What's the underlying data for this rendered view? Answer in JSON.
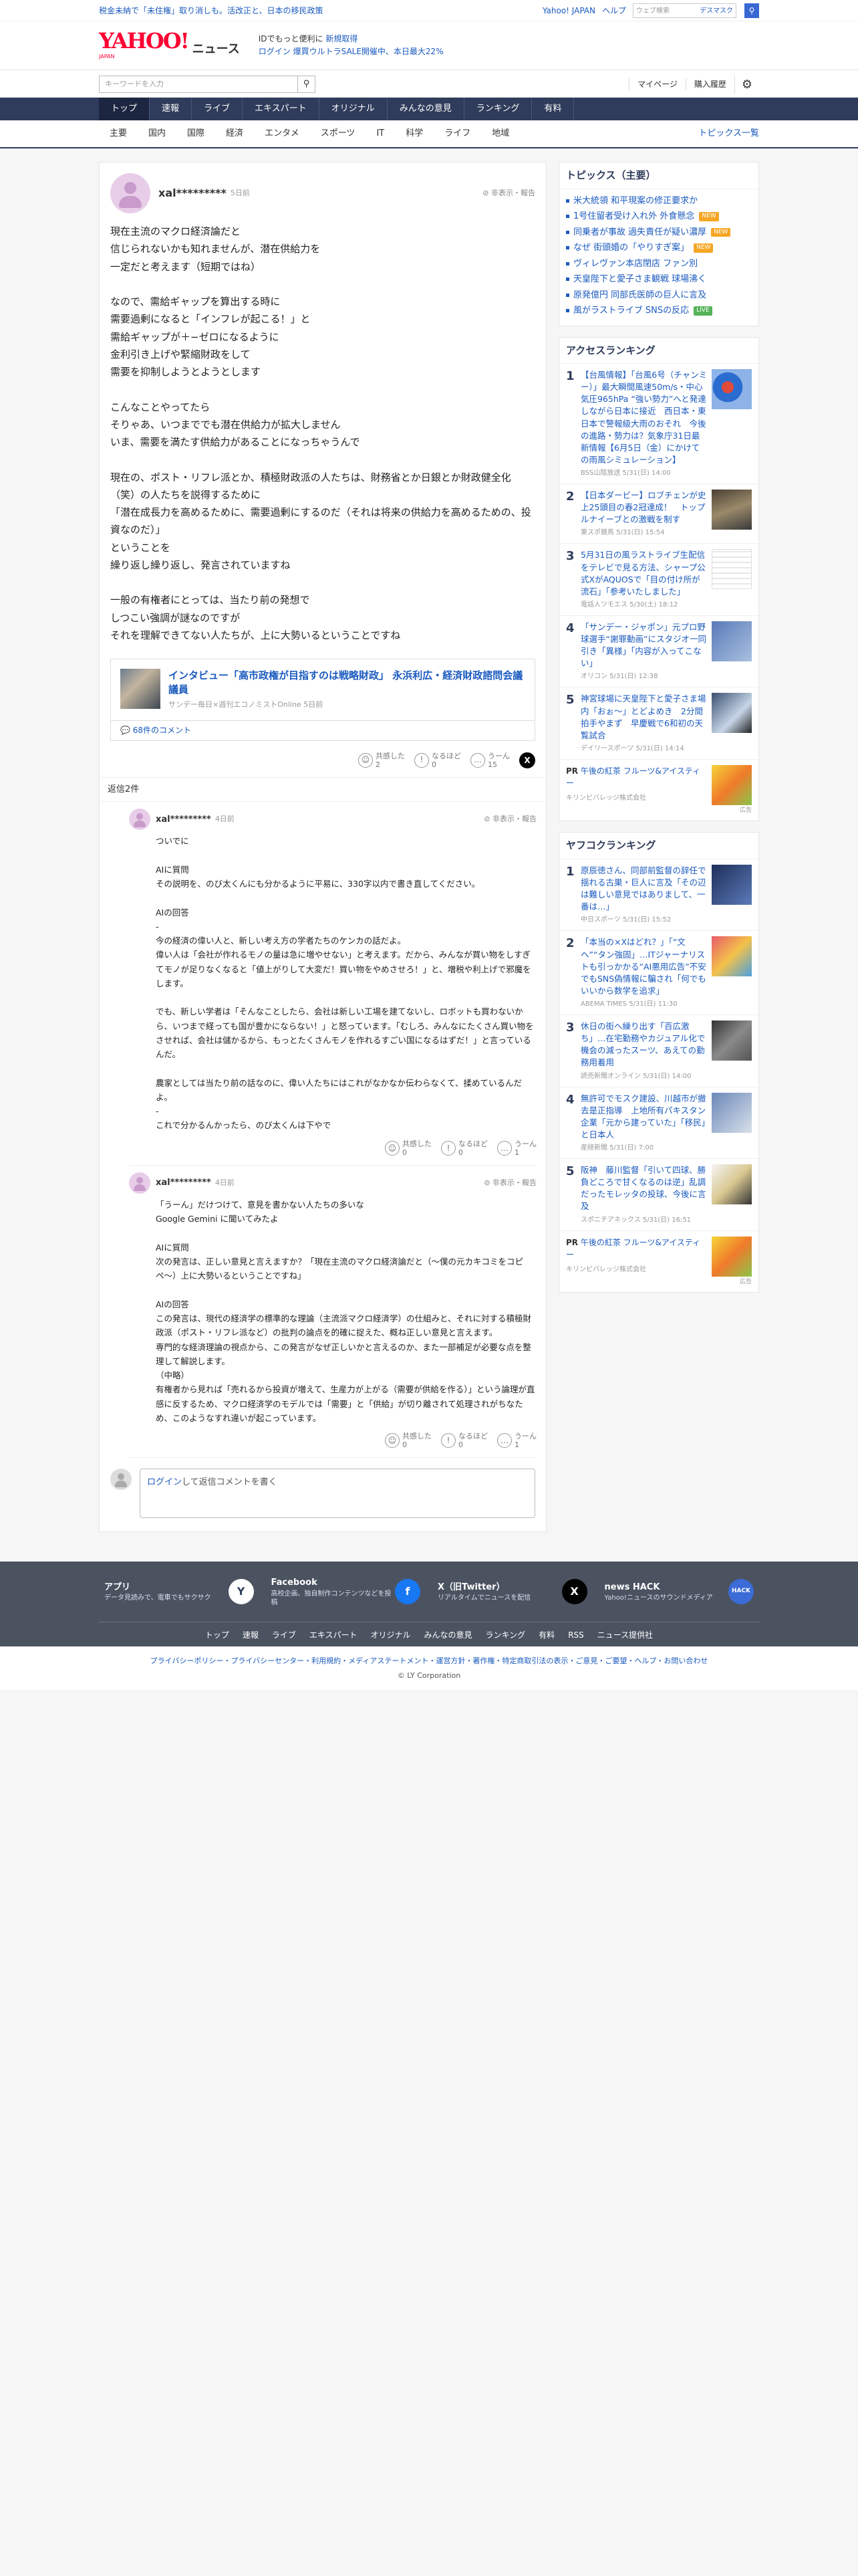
{
  "topbar": {
    "promo": "税金未納で「未住権」取り消しも。活改正と、日本の移民政策",
    "links": [
      "Yahoo! JAPAN",
      "ヘルプ"
    ],
    "search_placeholder": "ウェブ検索",
    "desmask": "デスマスク"
  },
  "header": {
    "logo_main": "YAHOO!",
    "logo_sub": "JAPAN",
    "logo_news": "ニュース",
    "msg1_a": "IDでもっと便利に",
    "msg1_b": "新規取得",
    "msg2_a": "ログイン",
    "msg2_b": "爆買ウルトラSALE開催中、本日最大22%"
  },
  "searchbar": {
    "placeholder": "キーワードを入力",
    "mypage": "マイページ",
    "history": "購入履歴"
  },
  "gnav": [
    "トップ",
    "速報",
    "ライブ",
    "エキスパート",
    "オリジナル",
    "みんなの意見",
    "ランキング",
    "有料"
  ],
  "cnav": [
    "主要",
    "国内",
    "国際",
    "経済",
    "エンタメ",
    "スポーツ",
    "IT",
    "科学",
    "ライフ",
    "地域"
  ],
  "cnav_more": "トピックス一覧",
  "post": {
    "user": "xal*********",
    "time": "5日前",
    "report": "非表示・報告",
    "body": "現在主流のマクロ経済論だと\n信じられないかも知れませんが、潜在供給力を\n一定だと考えます（短期ではね）\n\nなので、需給ギャップを算出する時に\n需要過剰になると「インフレが起こる！」と\n需給ギャップが＋−ゼロになるように\n金利引き上げや緊縮財政をして\n需要を抑制しようとようとします\n\nこんなことやってたら\nそりゃあ、いつまででも潜在供給力が拡大しません\nいま、需要を満たす供給力があることになっちゃうんで\n\n現在の、ポスト・リフレ派とか、積極財政派の人たちは、財務省とか日銀とか財政健全化（笑）の人たちを説得するために\n「潜在成長力を高めるために、需要過剰にするのだ（それは将来の供給力を高めるための、投資なのだ）」\nということを\n繰り返し繰り返し、発言されていますね\n\n一般の有権者にとっては、当たり前の発想で\nしつこい強調が謎なのですが\nそれを理解できてない人たちが、上に大勢いるということですね",
    "article_title": "インタビュー「高市政権が目指すのは戦略財政」 永浜利広・経済財政諮問会議議員",
    "article_source": "サンデー毎日×週刊エコノミストOnline 5日前",
    "comments_link": "68件のコメント",
    "reacts": [
      {
        "label": "共感した",
        "count": "2"
      },
      {
        "label": "なるほど",
        "count": "0"
      },
      {
        "label": "うーん",
        "count": "15"
      }
    ]
  },
  "replies_label": "返信2件",
  "replies": [
    {
      "user": "xal*********",
      "time": "4日前",
      "report": "非表示・報告",
      "body": "ついでに\n\nAIに質問\nその説明を、のび太くんにも分かるように平易に、330字以内で書き直してください。\n\nAIの回答\n-\n今の経済の偉い人と、新しい考え方の学者たちのケンカの話だよ。\n偉い人は「会社が作れるモノの量は急に増やせない」と考えます。だから、みんなが買い物をしすぎてモノが足りなくなると「値上がりして大変だ！買い物をやめさせろ！」と、増税や利上げで邪魔をします。\n\nでも、新しい学者は「そんなことしたら、会社は新しい工場を建てないし、ロボットも買わないから、いつまで経っても国が豊かにならない！」と怒っています。「むしろ、みんなにたくさん買い物をさせれば、会社は儲かるから、もっとたくさんモノを作れるすごい国になるはずだ！」と言っているんだ。\n\n農家としては当たり前の話なのに、偉い人たちにはこれがなかなか伝わらなくて、揉めているんだよ。\n-\nこれで分かるんかったら、のび太くんは下やで",
      "reacts": [
        {
          "label": "共感した",
          "count": "0"
        },
        {
          "label": "なるほど",
          "count": "0"
        },
        {
          "label": "うーん",
          "count": "1"
        }
      ]
    },
    {
      "user": "xal*********",
      "time": "4日前",
      "report": "非表示・報告",
      "body": "「うーん」だけつけて、意見を書かない人たちの多いな\nGoogle Gemini に聞いてみたよ\n\nAIに質問\n次の発言は、正しい意見と言えますか？「現在主流のマクロ経済論だと（〜僕の元カキコミをコピペ〜）上に大勢いるということですね」\n\nAIの回答\nこの発言は、現代の経済学の標準的な理論（主流派マクロ経済学）の仕組みと、それに対する積極財政派（ポスト・リフレ派など）の批判の論点を的確に捉えた、概ね正しい意見と言えます。\n専門的な経済理論の視点から、この発言がなぜ正しいかと言えるのか、また一部補足が必要な点を整理して解説します。\n（中略）\n有権者から見れば「売れるから投資が増えて、生産力が上がる（需要が供給を作る）」という論理が直感に反するため、マクロ経済学のモデルでは「需要」と「供給」が切り離されて処理されがちなため、このようなすれ違いが起こっています。",
      "reacts": [
        {
          "label": "共感した",
          "count": "0"
        },
        {
          "label": "なるほど",
          "count": "0"
        },
        {
          "label": "うーん",
          "count": "1"
        }
      ]
    }
  ],
  "comment_box": {
    "login": "ログイン",
    "text": "して返信コメントを書く"
  },
  "topics": {
    "title": "トピックス（主要）",
    "items": [
      {
        "text": "米大統領 和平現案の修正要求か",
        "tag": ""
      },
      {
        "text": "1号住留者受け入れ外 外食懸念",
        "tag": "NEW"
      },
      {
        "text": "同乗者が事故 過失責任が疑い濃厚",
        "tag": "NEW"
      },
      {
        "text": "なぜ 街頭婚の「やりすぎ案」",
        "tag": "NEW"
      },
      {
        "text": "ヴィレヴァン本店閉店 ファン別",
        "tag": ""
      },
      {
        "text": "天皇陛下と愛子さま観戦 球場沸く",
        "tag": ""
      },
      {
        "text": "原発億円 同部氏医師の巨人に言及",
        "tag": ""
      },
      {
        "text": "風がラストライブ SNSの反応",
        "tag": "LIVE"
      }
    ]
  },
  "access": {
    "title": "アクセスランキング",
    "items": [
      {
        "n": "1",
        "t": "【台風情報】「台風6号（チャンミー）」最大瞬間風速50m/s・中心気圧965hPa “強い勢力”へと発達しながら日本に接近　西日本・東日本で警報級大雨のおそれ　今後の進路・勢力は？気象庁31日最新情報【6月5日（金）にかけての雨風シミュレーション】",
        "s": "BSS山陰放送 5/31(日) 14:00"
      },
      {
        "n": "2",
        "t": "【日本ダービー】ロブチェンが史上25頭目の春2冠達成！　トップルナイーブとの激戦を制す",
        "s": "東スポ競馬 5/31(日) 15:54"
      },
      {
        "n": "3",
        "t": "5月31日の風ラストライブ生配信をテレビで見る方法、シャープ公式XがAQUOSで「目の付け所が流石」「参考いたしました」",
        "s": "電話人ツモエス 5/30(土) 18:12"
      },
      {
        "n": "4",
        "t": "「サンデー・ジャポン」元プロ野球選手“謝罪動画”にスタジオ一同引き「異様」「内容が入ってこない」",
        "s": "オリコン 5/31(日) 12:38"
      },
      {
        "n": "5",
        "t": "神宮球場に天皇陛下と愛子さま場内「おぉ〜」とどよめき　2分間拍手やまず　早慶戦で6和初の天覧試合",
        "s": "デイリースポーツ 5/31(日) 14:14"
      }
    ]
  },
  "pr1": {
    "label": "PR",
    "title": "午後の紅茶 フルーツ&アイスティー",
    "sponsor": "キリンビバレッジ株式会社",
    "ad": "広告"
  },
  "yafuku": {
    "title": "ヤフコクランキング",
    "items": [
      {
        "n": "1",
        "t": "原辰徳さん、同部前監督の辞任で揺れる古巣・巨人に言及「その辺は難しい意見ではありまして、一番は…」",
        "s": "中日スポーツ 5/31(日) 15:52"
      },
      {
        "n": "2",
        "t": "「本当の×Xはどれ？」「“文ヘ”“タン強固」…ITジャーナリストも引っかかる“AI悪用広告”不安でもSNS偽情報に騙され「何でもいいから数学を追求」",
        "s": "ABEMA TIMES 5/31(日) 11:30"
      },
      {
        "n": "3",
        "t": "休日の街へ繰り出す「百広激ち」…在宅勤務やカジュアル化で機会の減ったスーツ、あえての勤務用着用",
        "s": "読売新聞オンライン 5/31(日) 14:00"
      },
      {
        "n": "4",
        "t": "無許可でモスク建設、川越市が撤去是正指導　上地所有パキスタン企業「元から建っていた」「移民」と日本人",
        "s": "産経新聞 5/31(日) 7:00"
      },
      {
        "n": "5",
        "t": "阪神　藤川監督「引いて四球、勝負どころで甘くなるのは逆」乱調だったモレッタの投球、今後に言及",
        "s": "スポニチアネックス 5/31(日) 16:51"
      }
    ]
  },
  "pr2": {
    "label": "PR",
    "title": "午後の紅茶 フルーツ&アイスティー",
    "sponsor": "キリンビバレッジ株式会社",
    "ad": "広告"
  },
  "footer": {
    "cells": [
      {
        "t": "アプリ",
        "d": "データ見読みで、電車でもサクサク",
        "i": "Y"
      },
      {
        "t": "Facebook",
        "d": "高校企画、独自制作コンテンツなどを投稿",
        "i": "f"
      },
      {
        "t": "X（旧Twitter）",
        "d": "リアルタイムでニュースを配信",
        "i": "X"
      },
      {
        "t": "news HACK",
        "d": "Yahoo!ニュースのサウンドメディア",
        "i": "HACK"
      }
    ],
    "links": [
      "トップ",
      "速報",
      "ライブ",
      "エキスパート",
      "オリジナル",
      "みんなの意見",
      "ランキング",
      "有料",
      "RSS",
      "ニュース提供社"
    ],
    "bottom": "プライバシーポリシー・プライバシーセンター・利用規約・メディアステートメント・運営方針・著作権・特定商取引法の表示・ご意見・ご要望・ヘルプ・お問い合わせ",
    "copy": "© LY Corporation"
  }
}
